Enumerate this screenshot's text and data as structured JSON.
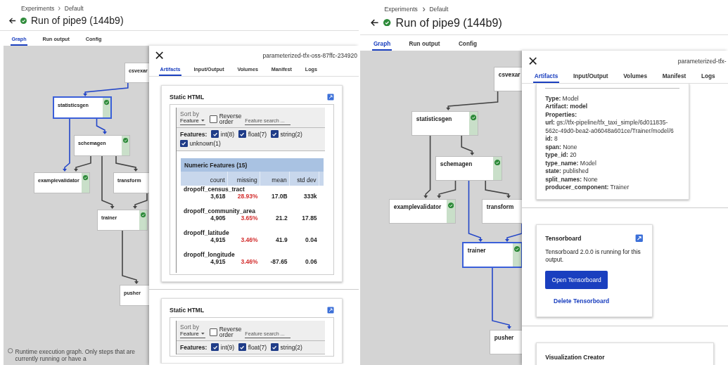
{
  "panes": [
    {
      "breadcrumbs": [
        "Experiments",
        "Default"
      ],
      "title": "Run of pipe9 (144b9)",
      "run_succeeded": true,
      "tabs": [
        {
          "label": "Graph",
          "selected": true
        },
        {
          "label": "Run output",
          "selected": false
        },
        {
          "label": "Config",
          "selected": false
        }
      ],
      "graph": {
        "nodes": [
          {
            "label": "csvexar",
            "selected": false
          },
          {
            "label": "statisticsgen",
            "succeeded": true,
            "selected": true
          },
          {
            "label": "schemagen",
            "succeeded": true,
            "selected": false
          },
          {
            "label": "examplevalidator",
            "succeeded": true,
            "selected": false
          },
          {
            "label": "transform",
            "selected": false
          },
          {
            "label": "trainer",
            "succeeded": true,
            "selected": false
          },
          {
            "label": "pusher",
            "selected": false
          }
        ],
        "note": "Runtime execution graph. Only steps that are currently running or have a"
      },
      "panel": {
        "pod_name": "parameterized-tfx-oss-87ffc-234920",
        "tabs": [
          {
            "label": "Artifacts",
            "selected": true
          },
          {
            "label": "Input/Output",
            "selected": false
          },
          {
            "label": "Volumes",
            "selected": false
          },
          {
            "label": "Manifest",
            "selected": false
          },
          {
            "label": "Logs",
            "selected": false
          }
        ],
        "cards": [
          {
            "kind": "static_html",
            "title": "Static HTML",
            "facets": {
              "sort_label": "Sort by",
              "sort_value": "Feature",
              "reverse": {
                "label": "Reverse order",
                "checked": false
              },
              "search_placeholder": "Feature search ...",
              "features_label": "Features:",
              "feature_types": [
                {
                  "label": "int(8)",
                  "checked": true
                },
                {
                  "label": "float(7)",
                  "checked": true
                },
                {
                  "label": "string(2)",
                  "checked": true
                },
                {
                  "label": "unknown(1)",
                  "checked": true
                }
              ],
              "table": {
                "title": "Numeric Features (15)",
                "columns": [
                  "count",
                  "missing",
                  "mean",
                  "std dev"
                ],
                "rows": [
                  {
                    "name": "dropoff_census_tract",
                    "values": [
                      "3,618",
                      "28.93%",
                      "17.0B",
                      "333k"
                    ]
                  },
                  {
                    "name": "dropoff_community_area",
                    "values": [
                      "4,905",
                      "3.65%",
                      "21.2",
                      "17.85"
                    ]
                  },
                  {
                    "name": "dropoff_latitude",
                    "values": [
                      "4,915",
                      "3.46%",
                      "41.9",
                      "0.04"
                    ]
                  },
                  {
                    "name": "dropoff_longitude",
                    "values": [
                      "4,915",
                      "3.46%",
                      "-87.65",
                      "0.06"
                    ]
                  }
                ]
              }
            }
          },
          {
            "kind": "static_html",
            "title": "Static HTML",
            "facets": {
              "sort_label": "Sort by",
              "sort_value": "Feature",
              "reverse": {
                "label": "Reverse order",
                "checked": false
              },
              "search_placeholder": "Feature search ...",
              "features_label": "Features:",
              "feature_types": [
                {
                  "label": "int(9)",
                  "checked": true
                },
                {
                  "label": "float(7)",
                  "checked": true
                },
                {
                  "label": "string(2)",
                  "checked": true
                }
              ]
            }
          }
        ]
      }
    },
    {
      "breadcrumbs": [
        "Experiments",
        "Default"
      ],
      "title": "Run of pipe9 (144b9)",
      "run_succeeded": true,
      "tabs": [
        {
          "label": "Graph",
          "selected": true
        },
        {
          "label": "Run output",
          "selected": false
        },
        {
          "label": "Config",
          "selected": false
        }
      ],
      "graph": {
        "nodes": [
          {
            "label": "csvexar",
            "selected": false
          },
          {
            "label": "statisticsgen",
            "succeeded": true,
            "selected": false
          },
          {
            "label": "schemagen",
            "succeeded": true,
            "selected": false
          },
          {
            "label": "examplevalidator",
            "succeeded": true,
            "selected": false
          },
          {
            "label": "transform",
            "selected": false
          },
          {
            "label": "trainer",
            "succeeded": true,
            "selected": true
          },
          {
            "label": "pusher",
            "selected": false
          }
        ]
      },
      "panel": {
        "pod_name": "parameterized-tfx-",
        "tabs": [
          {
            "label": "Artifacts",
            "selected": true
          },
          {
            "label": "Input/Output",
            "selected": false
          },
          {
            "label": "Volumes",
            "selected": false
          },
          {
            "label": "Manifest",
            "selected": false
          },
          {
            "label": "Logs",
            "selected": false
          }
        ],
        "cards": [
          {
            "kind": "properties",
            "lines": [
              {
                "key": "Type:",
                "value": "Model"
              },
              {
                "key": "Artifact: model"
              },
              {
                "key": "Properties:"
              },
              {
                "key": "url:",
                "value": "gs://tfx-pipeline/tfx_taxi_simple/6d011835-562c-49d0-bea2-a06048a601ce/Trainer/model/6"
              },
              {
                "key": "id:",
                "value": "8"
              },
              {
                "key": "span:",
                "value": "None"
              },
              {
                "key": "type_id:",
                "value": "20"
              },
              {
                "key": "type_name:",
                "value": "Model"
              },
              {
                "key": "state:",
                "value": "published"
              },
              {
                "key": "split_names:",
                "value": "None"
              },
              {
                "key": "producer_component:",
                "value": "Trainer"
              }
            ]
          },
          {
            "kind": "tensorboard",
            "title": "Tensorboard",
            "message": "Tensorboard 2.0.0 is running for this output.",
            "primary_action": "Open Tensorboard",
            "secondary_action": "Delete Tensorboard"
          },
          {
            "kind": "visualization_creator",
            "title": "Visualization Creator"
          }
        ]
      }
    }
  ]
}
